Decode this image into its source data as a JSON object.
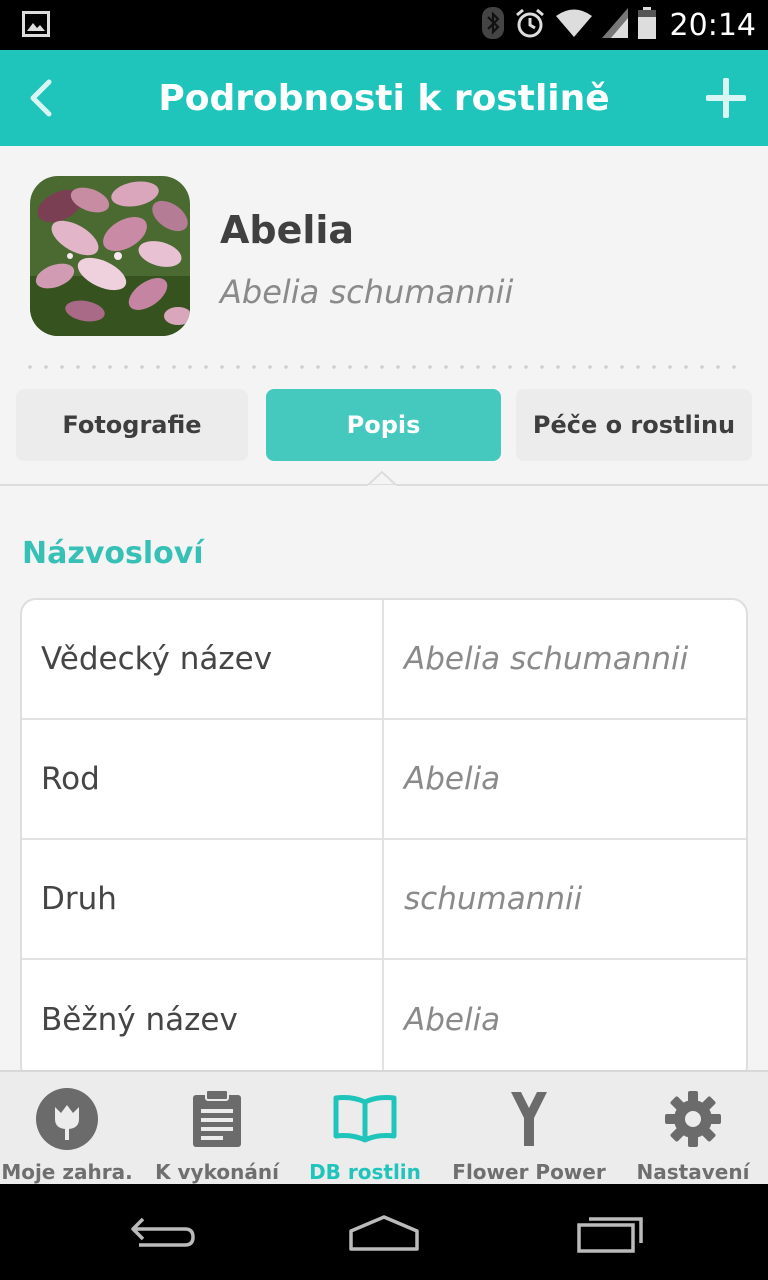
{
  "status_bar": {
    "time": "20:14",
    "icons": [
      "image-icon",
      "bluetooth-icon",
      "alarm-icon",
      "wifi-icon",
      "signal-icon",
      "battery-icon"
    ]
  },
  "app_bar": {
    "title": "Podrobnosti k rostlině",
    "back_icon": "chevron-left-icon",
    "add_icon": "plus-icon"
  },
  "plant": {
    "name": "Abelia",
    "latin_name": "Abelia schumannii"
  },
  "tabs": [
    {
      "label": "Fotografie",
      "active": false
    },
    {
      "label": "Popis",
      "active": true
    },
    {
      "label": "Péče o rostlinu",
      "active": false
    }
  ],
  "section": {
    "title": "Názvosloví",
    "rows": [
      {
        "key": "Vědecký název",
        "value": "Abelia schumannii"
      },
      {
        "key": "Rod",
        "value": "Abelia"
      },
      {
        "key": "Druh",
        "value": "schumannii"
      },
      {
        "key": "Běžný název",
        "value": "Abelia"
      }
    ]
  },
  "bottom_nav": [
    {
      "label": "Moje zahra.",
      "icon": "flower-badge-icon",
      "active": false
    },
    {
      "label": "K vykonání",
      "icon": "clipboard-icon",
      "active": false
    },
    {
      "label": "DB rostlin",
      "icon": "open-book-icon",
      "active": true
    },
    {
      "label": "Flower Power",
      "icon": "flower-power-sensor-icon",
      "active": false
    },
    {
      "label": "Nastavení",
      "icon": "gear-icon",
      "active": false
    }
  ],
  "colors": {
    "accent": "#1fc4bb",
    "tab_active": "#45c9bf",
    "section_title": "#37c0b6",
    "text_dark": "#404040",
    "text_muted": "#8a8a8a",
    "nav_inactive": "#6f6f6f"
  },
  "system_nav": [
    "back-icon",
    "home-icon",
    "recents-icon"
  ]
}
